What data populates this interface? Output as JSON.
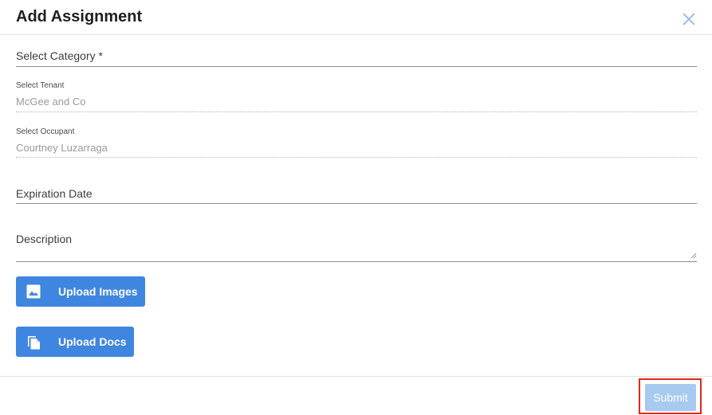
{
  "dialog": {
    "title": "Add Assignment",
    "close_icon": "close-icon"
  },
  "form": {
    "category": {
      "label": "Select Category *"
    },
    "tenant": {
      "label": "Select Tenant",
      "value": "McGee and Co"
    },
    "occupant": {
      "label": "Select Occupant",
      "value": "Courtney Luzarraga"
    },
    "expiration": {
      "label": "Expiration Date"
    },
    "description": {
      "label": "Description"
    }
  },
  "uploads": {
    "images": {
      "label": "Upload Images",
      "icon": "image-icon"
    },
    "docs": {
      "label": "Upload Docs",
      "icon": "file-copy-icon"
    }
  },
  "footer": {
    "submit_label": "Submit"
  },
  "colors": {
    "primary": "#3f86e0",
    "submit_disabled": "#a8c9f0",
    "highlight": "#e0281b",
    "close_icon": "#8fb4e6"
  }
}
